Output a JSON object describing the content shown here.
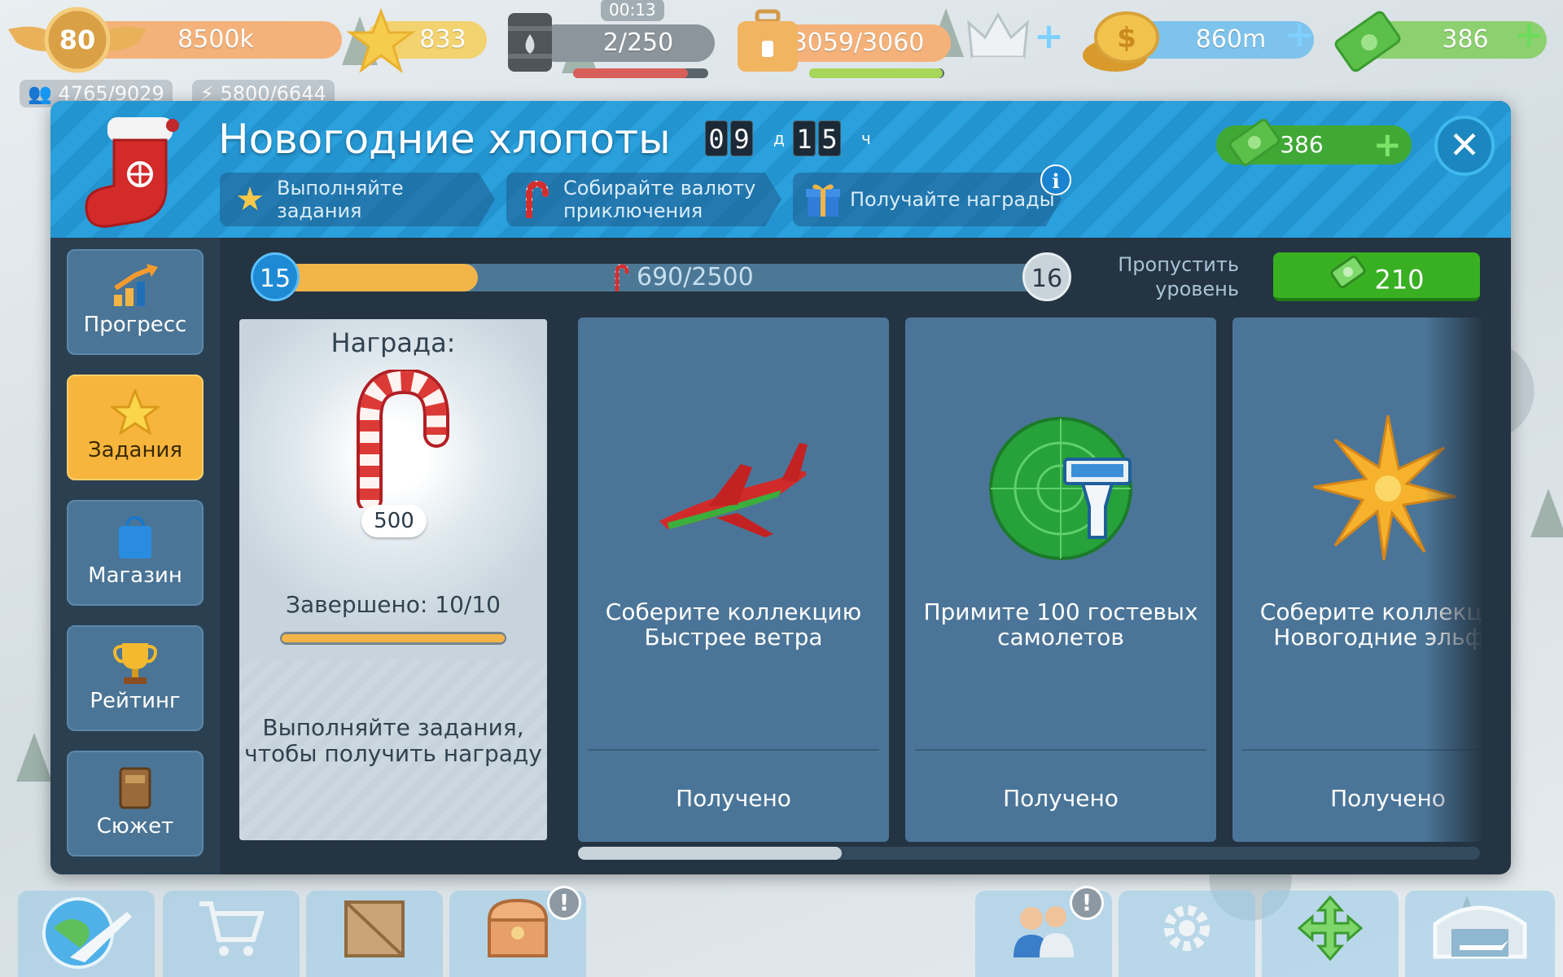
{
  "hud": {
    "level": "80",
    "xp": "8500k",
    "stars": "833",
    "fuel_timer": "00:13",
    "fuel": "2/250",
    "cargo": "3059/3060",
    "coins": "860m",
    "cash": "386",
    "passengers": "4765/9029",
    "power": "5800/6644",
    "colors": {
      "xp_bar": "#f4b27a",
      "star_bar": "#f3d270",
      "coin_bar": "#7ec3ec",
      "cash_bar": "#8dd06f"
    }
  },
  "panel": {
    "title": "Новогодние хлопоты",
    "timer": {
      "days": [
        "0",
        "9"
      ],
      "days_unit": "д",
      "hours": [
        "1",
        "5"
      ],
      "hours_unit": "ч"
    },
    "steps": [
      {
        "icon": "star-icon",
        "label": "Выполняйте задания"
      },
      {
        "icon": "candy-cane-icon",
        "label": "Собирайте валюту приключения"
      },
      {
        "icon": "gift-icon",
        "label": "Получайте награды"
      }
    ],
    "info_label": "i",
    "cash": "386",
    "close_label": "✕"
  },
  "sidebar": {
    "items": [
      {
        "label": "Прогресс",
        "icon": "progress-chart-icon",
        "active": false
      },
      {
        "label": "Задания",
        "icon": "star-icon",
        "active": true
      },
      {
        "label": "Магазин",
        "icon": "shopping-bag-icon",
        "active": false
      },
      {
        "label": "Рейтинг",
        "icon": "trophy-icon",
        "active": false
      },
      {
        "label": "Сюжет",
        "icon": "book-icon",
        "active": false
      }
    ]
  },
  "progress": {
    "current_level": "15",
    "next_level": "16",
    "text": "690/2500",
    "value": 690,
    "max": 2500,
    "skip_label": "Пропустить уровень",
    "skip_cost": "210"
  },
  "reward": {
    "title": "Награда:",
    "amount": "500",
    "completed": "Завершено: 10/10",
    "completed_fraction": 1.0,
    "hint": "Выполняйте задания, чтобы получить награду"
  },
  "tasks": [
    {
      "text": "Соберите коллекцию Быстрее ветра",
      "status": "Получено",
      "icon": "red-jet-icon"
    },
    {
      "text": "Примите 100 гостевых самолетов",
      "status": "Получено",
      "icon": "radar-tower-icon"
    },
    {
      "text": "Соберите коллекцию Новогодние эльфы",
      "status": "Получено",
      "icon": "golden-star-ornament-icon"
    }
  ],
  "scroll": {
    "position_fraction": 0.0,
    "visible_fraction": 0.29
  },
  "bottom_bar": {
    "items": [
      {
        "icon": "globe-plane-icon"
      },
      {
        "icon": "shopping-cart-icon"
      },
      {
        "icon": "crate-icon"
      },
      {
        "icon": "treasure-chest-icon",
        "alert": "!"
      },
      {
        "icon": "staff-icon",
        "alert": "!"
      },
      {
        "icon": "settings-gear-icon"
      },
      {
        "icon": "move-arrows-icon"
      },
      {
        "icon": "hangar-icon"
      }
    ]
  }
}
